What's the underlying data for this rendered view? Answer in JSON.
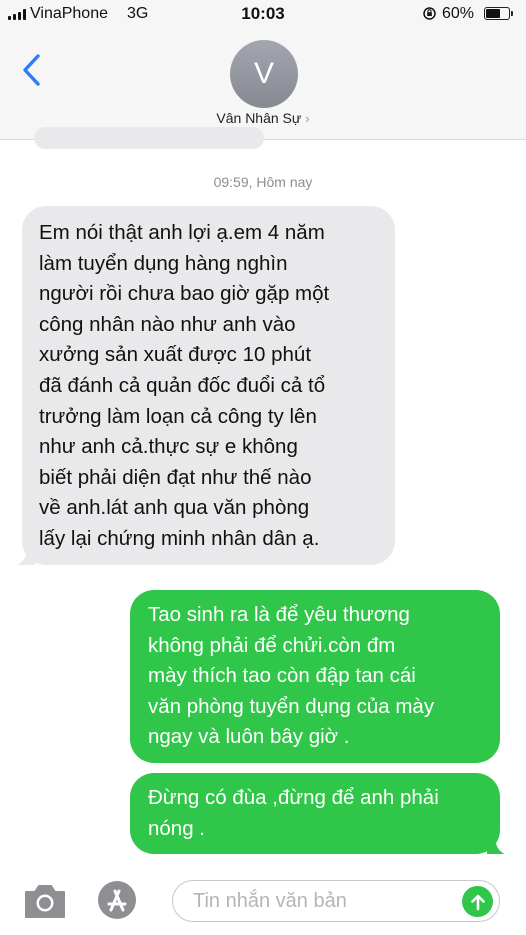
{
  "status_bar": {
    "carrier": "VinaPhone",
    "network": "3G",
    "time": "10:03",
    "battery_text": "60%",
    "battery_level": 0.6,
    "icons": [
      "signal-icon",
      "orientation-lock-icon",
      "battery-icon"
    ]
  },
  "header": {
    "avatar_initial": "V",
    "contact_name": "Vân Nhân Sự",
    "chevron": "›",
    "icons": [
      "back-chevron-icon",
      "contact-chevron-icon"
    ]
  },
  "conversation": {
    "timestamp": "09:59, Hôm nay",
    "messages": [
      {
        "direction": "incoming",
        "lines": [
          "Em nói thật anh lợi ạ.em 4 năm",
          "làm tuyển dụng hàng nghìn",
          "người rồi chưa bao giờ gặp một",
          "công nhân nào như anh vào",
          "xưởng sản xuất được 10 phút",
          "đã đánh cả quản đốc đuổi cả tổ",
          "trưởng làm loạn cả công ty lên",
          "như anh cả.thực sự e không",
          "biết phải diện đạt như thế nào",
          "về anh.lát anh qua văn phòng",
          "lấy lại chứng minh nhân dân ạ."
        ]
      },
      {
        "direction": "outgoing",
        "lines": [
          "Tao sinh ra là để yêu thương",
          "không phải để chửi.còn đm",
          "mày thích tao còn đập tan cái",
          "văn phòng tuyển dụng của mày",
          "ngay và luôn bây giờ ."
        ]
      },
      {
        "direction": "outgoing",
        "lines": [
          "Đừng có đùa ,đừng để anh phải",
          "nóng ."
        ]
      }
    ]
  },
  "input_bar": {
    "placeholder": "Tin nhắn văn bản",
    "icons": [
      "camera-icon",
      "app-store-icon",
      "send-arrow-icon"
    ]
  },
  "colors": {
    "incoming_bubble": "#e9e9eb",
    "outgoing_bubble": "#2fc64a",
    "accent_blue": "#2b7cf6",
    "timestamp_gray": "#8e8e93"
  }
}
